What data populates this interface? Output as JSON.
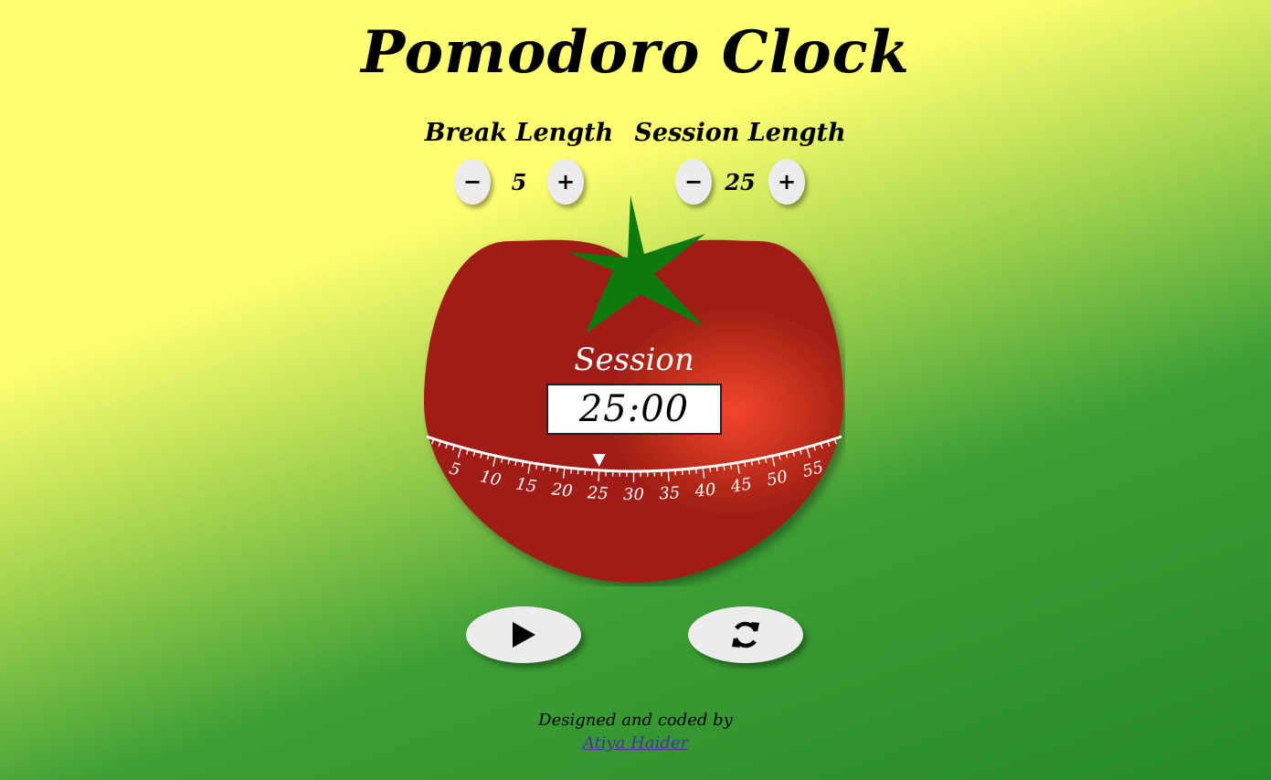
{
  "app": {
    "title": "Pomodoro Clock"
  },
  "break_control": {
    "label": "Break Length",
    "value": "5",
    "decrement": "−",
    "increment": "+"
  },
  "session_control": {
    "label": "Session Length",
    "value": "25",
    "decrement": "−",
    "increment": "+"
  },
  "timer": {
    "mode": "Session",
    "time": "25:00",
    "dial_labels": [
      "5",
      "10",
      "15",
      "20",
      "25",
      "30",
      "35",
      "40",
      "45",
      "50",
      "55"
    ],
    "pointer_minutes": 25
  },
  "actions": {
    "play_icon": "play-icon",
    "reset_icon": "refresh-icon"
  },
  "footer": {
    "credit": "Designed and coded by",
    "author": "Atiya Haider"
  },
  "colors": {
    "tomato": "#a01f12",
    "tomato_highlight": "#f2452c",
    "leaf": "#0c7a0c",
    "button": "#ececec"
  }
}
